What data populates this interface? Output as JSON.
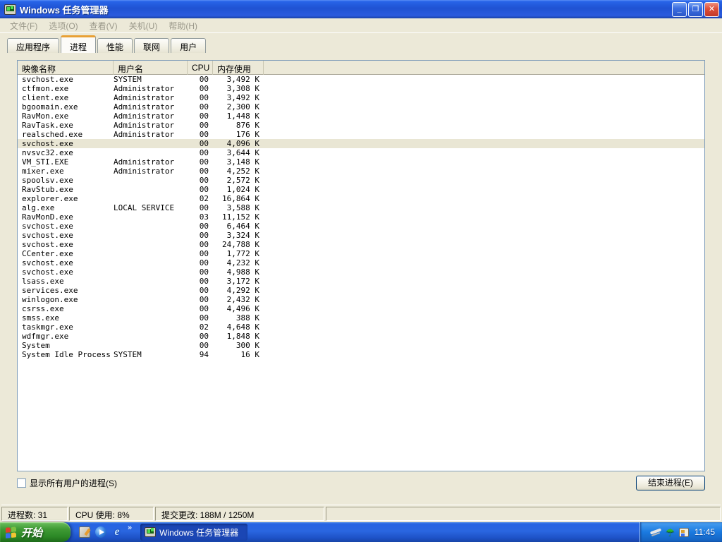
{
  "window": {
    "title": "Windows 任务管理器",
    "controls": {
      "minimize": "_",
      "restore": "❐",
      "close": "✕"
    }
  },
  "menu": {
    "items": [
      "文件(F)",
      "选项(O)",
      "查看(V)",
      "关机(U)",
      "帮助(H)"
    ]
  },
  "tabs": [
    {
      "label": "应用程序",
      "active": false
    },
    {
      "label": "进程",
      "active": true
    },
    {
      "label": "性能",
      "active": false
    },
    {
      "label": "联网",
      "active": false
    },
    {
      "label": "用户",
      "active": false
    }
  ],
  "process_table": {
    "columns": [
      "映像名称",
      "用户名",
      "CPU",
      "内存使用"
    ],
    "rows": [
      {
        "name": "svchost.exe",
        "user": "SYSTEM",
        "cpu": "00",
        "mem": "3,492 K",
        "selected": false
      },
      {
        "name": "ctfmon.exe",
        "user": "Administrator",
        "cpu": "00",
        "mem": "3,308 K",
        "selected": false
      },
      {
        "name": "client.exe",
        "user": "Administrator",
        "cpu": "00",
        "mem": "3,492 K",
        "selected": false
      },
      {
        "name": "bgoomain.exe",
        "user": "Administrator",
        "cpu": "00",
        "mem": "2,300 K",
        "selected": false
      },
      {
        "name": "RavMon.exe",
        "user": "Administrator",
        "cpu": "00",
        "mem": "1,448 K",
        "selected": false
      },
      {
        "name": "RavTask.exe",
        "user": "Administrator",
        "cpu": "00",
        "mem": "876 K",
        "selected": false
      },
      {
        "name": "realsched.exe",
        "user": "Administrator",
        "cpu": "00",
        "mem": "176 K",
        "selected": false
      },
      {
        "name": "svchost.exe",
        "user": "",
        "cpu": "00",
        "mem": "4,096 K",
        "selected": true
      },
      {
        "name": "nvsvc32.exe",
        "user": "",
        "cpu": "00",
        "mem": "3,644 K",
        "selected": false
      },
      {
        "name": "VM_STI.EXE",
        "user": "Administrator",
        "cpu": "00",
        "mem": "3,148 K",
        "selected": false
      },
      {
        "name": "mixer.exe",
        "user": "Administrator",
        "cpu": "00",
        "mem": "4,252 K",
        "selected": false
      },
      {
        "name": "spoolsv.exe",
        "user": "",
        "cpu": "00",
        "mem": "2,572 K",
        "selected": false
      },
      {
        "name": "RavStub.exe",
        "user": "",
        "cpu": "00",
        "mem": "1,024 K",
        "selected": false
      },
      {
        "name": "explorer.exe",
        "user": "",
        "cpu": "02",
        "mem": "16,864 K",
        "selected": false
      },
      {
        "name": "alg.exe",
        "user": "LOCAL SERVICE",
        "cpu": "00",
        "mem": "3,588 K",
        "selected": false
      },
      {
        "name": "RavMonD.exe",
        "user": "",
        "cpu": "03",
        "mem": "11,152 K",
        "selected": false
      },
      {
        "name": "svchost.exe",
        "user": "",
        "cpu": "00",
        "mem": "6,464 K",
        "selected": false
      },
      {
        "name": "svchost.exe",
        "user": "",
        "cpu": "00",
        "mem": "3,324 K",
        "selected": false
      },
      {
        "name": "svchost.exe",
        "user": "",
        "cpu": "00",
        "mem": "24,788 K",
        "selected": false
      },
      {
        "name": "CCenter.exe",
        "user": "",
        "cpu": "00",
        "mem": "1,772 K",
        "selected": false
      },
      {
        "name": "svchost.exe",
        "user": "",
        "cpu": "00",
        "mem": "4,232 K",
        "selected": false
      },
      {
        "name": "svchost.exe",
        "user": "",
        "cpu": "00",
        "mem": "4,988 K",
        "selected": false
      },
      {
        "name": "lsass.exe",
        "user": "",
        "cpu": "00",
        "mem": "3,172 K",
        "selected": false
      },
      {
        "name": "services.exe",
        "user": "",
        "cpu": "00",
        "mem": "4,292 K",
        "selected": false
      },
      {
        "name": "winlogon.exe",
        "user": "",
        "cpu": "00",
        "mem": "2,432 K",
        "selected": false
      },
      {
        "name": "csrss.exe",
        "user": "",
        "cpu": "00",
        "mem": "4,496 K",
        "selected": false
      },
      {
        "name": "smss.exe",
        "user": "",
        "cpu": "00",
        "mem": "388 K",
        "selected": false
      },
      {
        "name": "taskmgr.exe",
        "user": "",
        "cpu": "02",
        "mem": "4,648 K",
        "selected": false
      },
      {
        "name": "wdfmgr.exe",
        "user": "",
        "cpu": "00",
        "mem": "1,848 K",
        "selected": false
      },
      {
        "name": "System",
        "user": "",
        "cpu": "00",
        "mem": "300 K",
        "selected": false
      },
      {
        "name": "System Idle Process",
        "user": "SYSTEM",
        "cpu": "94",
        "mem": "16 K",
        "selected": false
      }
    ]
  },
  "footer": {
    "show_all_users_label": "显示所有用户的进程(S)",
    "show_all_users_checked": false,
    "end_process_label": "结束进程(E)"
  },
  "statusbar": {
    "processes": "进程数: 31",
    "cpu_usage": "CPU 使用: 8%",
    "commit_charge": "提交更改: 188M / 1250M"
  },
  "taskbar": {
    "start_label": "开始",
    "quick_launch_icons": [
      "show-desktop",
      "media-player",
      "internet-explorer"
    ],
    "overflow_chevron": "»",
    "task_button_label": "Windows 任务管理器",
    "tray_icons": [
      "graphics-swoosh",
      "rising-antivirus-umbrella",
      "input-language"
    ],
    "clock": "11:45"
  },
  "colors": {
    "window_chrome": "#ece9d8",
    "titlebar_blue": "#2a5ade",
    "active_tab_accent": "#e8a034",
    "selected_row": "#e9e6d4",
    "taskbar_blue": "#2a66e0",
    "start_green": "#3f9a35"
  }
}
